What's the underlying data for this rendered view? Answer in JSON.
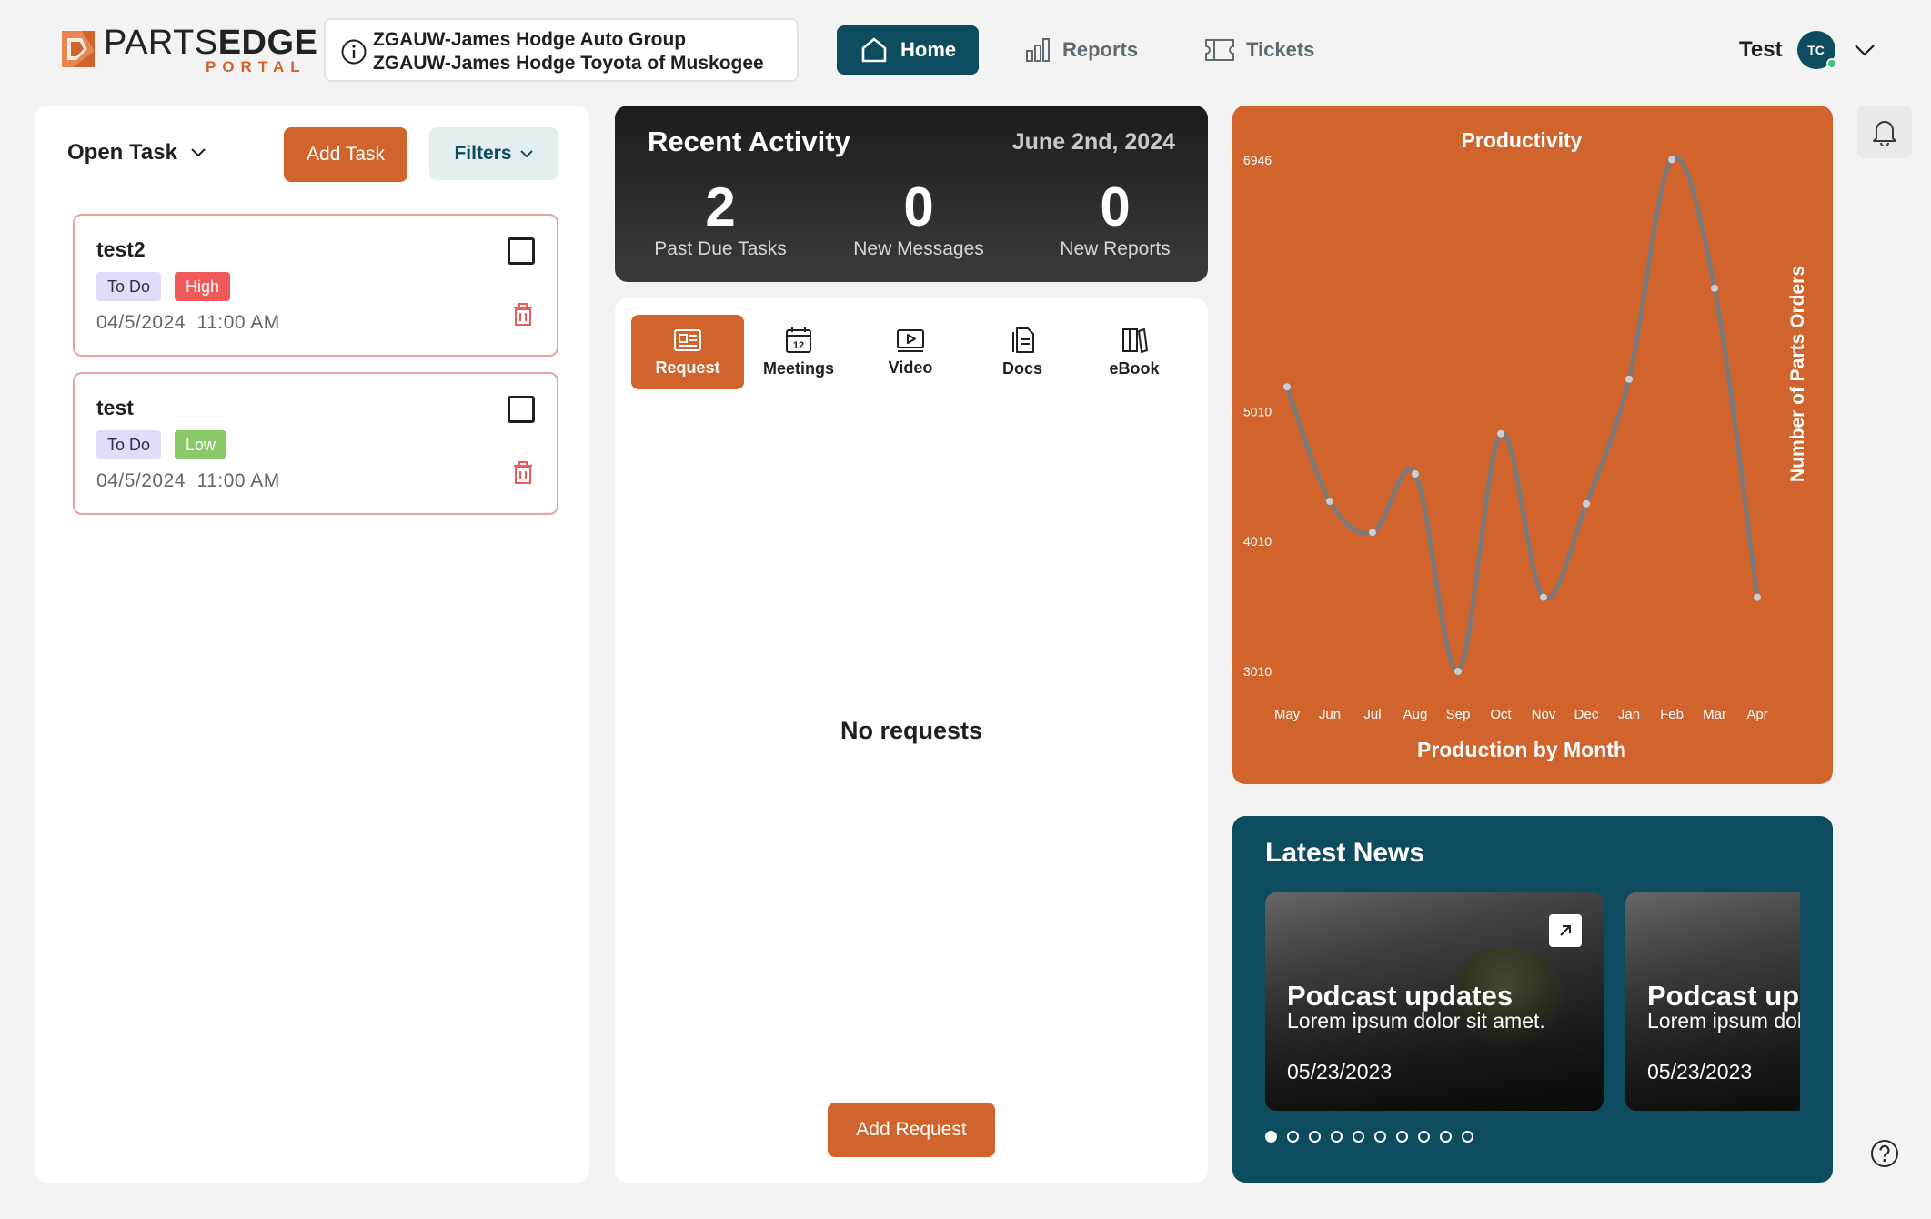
{
  "header": {
    "logo": {
      "word_light": "PARTS",
      "word_bold": "EDGE",
      "sub": "PORTAL"
    },
    "dealer": {
      "group": "ZGAUW-James Hodge Auto Group",
      "store": "ZGAUW-James Hodge Toyota of Muskogee",
      "icon": "info-icon"
    },
    "nav": {
      "home": "Home",
      "reports": "Reports",
      "tickets": "Tickets"
    },
    "user": {
      "name": "Test",
      "initials": "TC",
      "status_color": "#39c27a"
    }
  },
  "tasks": {
    "dropdown_label": "Open Task",
    "add_label": "Add Task",
    "filters_label": "Filters",
    "items": [
      {
        "name": "test2",
        "status": "To Do",
        "priority": "High",
        "date": "04/5/2024",
        "time": "11:00 AM"
      },
      {
        "name": "test",
        "status": "To Do",
        "priority": "Low",
        "date": "04/5/2024",
        "time": "11:00 AM"
      }
    ]
  },
  "activity": {
    "title": "Recent Activity",
    "date": "June 2nd, 2024",
    "stats": [
      {
        "value": "2",
        "label": "Past Due Tasks"
      },
      {
        "value": "0",
        "label": "New Messages"
      },
      {
        "value": "0",
        "label": "New Reports"
      }
    ]
  },
  "requests": {
    "tabs": [
      {
        "label": "Request",
        "icon": "request-icon",
        "active": true
      },
      {
        "label": "Meetings",
        "icon": "calendar-icon",
        "active": false
      },
      {
        "label": "Video",
        "icon": "video-icon",
        "active": false
      },
      {
        "label": "Docs",
        "icon": "docs-icon",
        "active": false
      },
      {
        "label": "eBook",
        "icon": "ebook-icon",
        "active": false
      }
    ],
    "calendar_day": "12",
    "empty_text": "No requests",
    "add_label": "Add Request"
  },
  "chart_data": {
    "type": "line",
    "title": "Productivity",
    "xlabel": "Production by Month",
    "ylabel": "Number of Parts Orders",
    "categories": [
      "May",
      "Jun",
      "Jul",
      "Aug",
      "Sep",
      "Oct",
      "Nov",
      "Dec",
      "Jan",
      "Feb",
      "Mar",
      "Apr"
    ],
    "yticks": [
      6946,
      5010,
      4010,
      3010
    ],
    "ylim": [
      3010,
      6946
    ],
    "series": [
      {
        "values": [
          5200,
          4320,
          4080,
          4530,
          3010,
          4840,
          3580,
          4300,
          5260,
          6950,
          5960,
          3580
        ]
      }
    ],
    "smooth": true,
    "grid": false,
    "legend": "none",
    "background": "#d0642c",
    "line_color": "#7a7a7a",
    "point_color": "#c8ced6"
  },
  "news": {
    "title": "Latest News",
    "cards": [
      {
        "headline": "Podcast updates",
        "body": "Lorem ipsum dolor sit amet.",
        "date": "05/23/2023"
      },
      {
        "headline": "Podcast updates",
        "body": "Lorem ipsum dolor sit amet.",
        "date": "05/23/2023"
      }
    ],
    "page_count": 10,
    "active_page": 0
  },
  "colors": {
    "accent": "#d0642c",
    "brand": "#0d4b5f",
    "high": "#f05a5a",
    "low": "#8ac96a"
  }
}
